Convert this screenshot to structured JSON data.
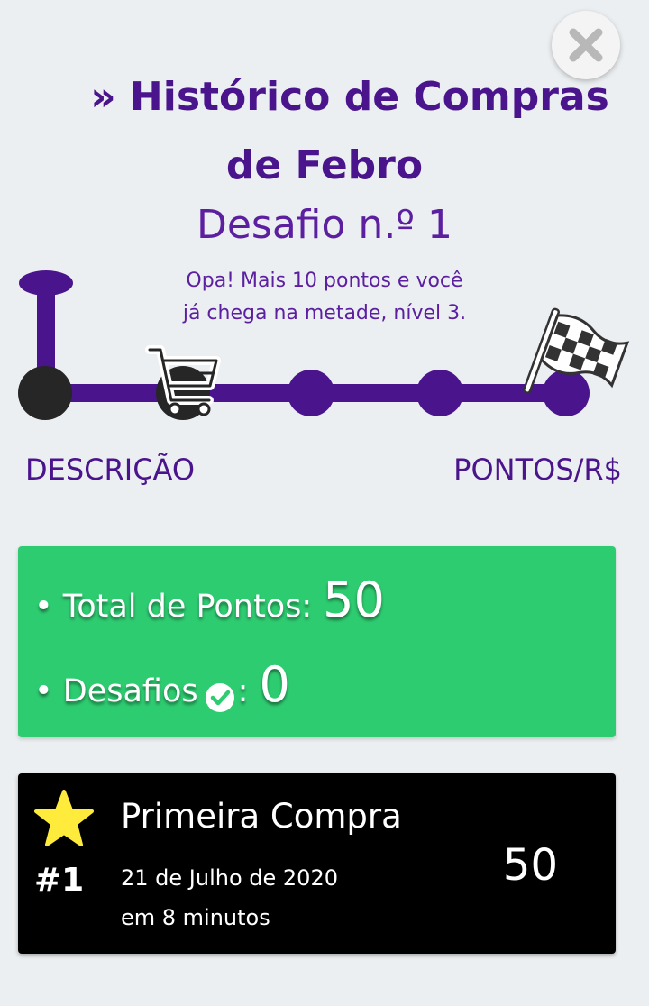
{
  "header": {
    "title_line1": "» Histórico de Compras",
    "title_line2": "de Febro",
    "challenge": "Desafio n.º 1",
    "tip_line1": "Opa! Mais 10 pontos e você",
    "tip_line2": "já chega na metade, nível 3."
  },
  "progress": {
    "steps": 5,
    "current_step": 2,
    "label_left": "DESCRIÇÃO",
    "label_right": "PONTOS/R$"
  },
  "summary": {
    "total_label": "• Total de Pontos:",
    "total_value": "50",
    "challenges_label": "• Desafios",
    "challenges_colon": ":",
    "challenges_value": "0"
  },
  "purchases": [
    {
      "rank": "#1",
      "name": "Primeira Compra",
      "date": "21 de Julho de 2020",
      "time_ago": "em 8 minutos",
      "points": "50"
    }
  ],
  "icons": {
    "close": "close-icon",
    "cart": "shopping-cart-icon",
    "flag": "checkered-flag-icon",
    "check": "check-circle-icon",
    "star": "star-icon"
  },
  "colors": {
    "purple": "#4a148c",
    "green": "#2ecc71",
    "star": "#ffeb3b",
    "card_dark": "#000000"
  }
}
